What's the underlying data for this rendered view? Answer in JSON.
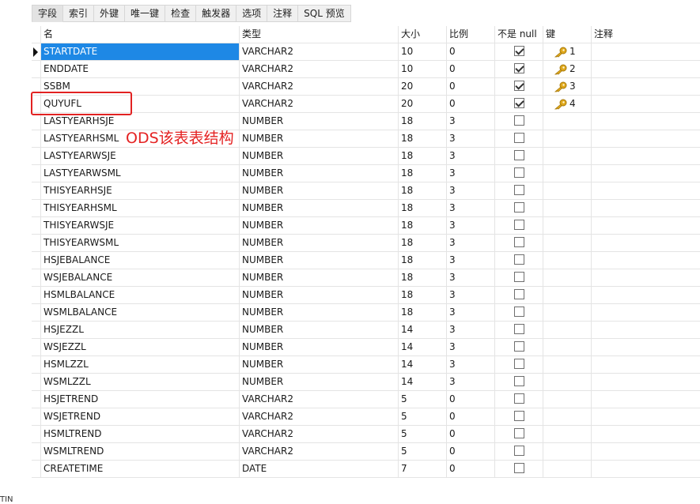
{
  "tabs": [
    {
      "label": "字段",
      "active": true
    },
    {
      "label": "索引",
      "active": false
    },
    {
      "label": "外键",
      "active": false
    },
    {
      "label": "唯一键",
      "active": false
    },
    {
      "label": "检查",
      "active": false
    },
    {
      "label": "触发器",
      "active": false
    },
    {
      "label": "选项",
      "active": false
    },
    {
      "label": "注释",
      "active": false
    },
    {
      "label": "SQL 预览",
      "active": false
    }
  ],
  "columns": {
    "name": "名",
    "type": "类型",
    "size": "大小",
    "scale": "比例",
    "not_null": "不是 null",
    "key": "键",
    "comment": "注释"
  },
  "rows": [
    {
      "name": "STARTDATE",
      "type": "VARCHAR2",
      "size": "10",
      "scale": "0",
      "not_null": true,
      "key": "1"
    },
    {
      "name": "ENDDATE",
      "type": "VARCHAR2",
      "size": "10",
      "scale": "0",
      "not_null": true,
      "key": "2"
    },
    {
      "name": "SSBM",
      "type": "VARCHAR2",
      "size": "20",
      "scale": "0",
      "not_null": true,
      "key": "3"
    },
    {
      "name": "QUYUFL",
      "type": "VARCHAR2",
      "size": "20",
      "scale": "0",
      "not_null": true,
      "key": "4"
    },
    {
      "name": "LASTYEARHSJE",
      "type": "NUMBER",
      "size": "18",
      "scale": "3",
      "not_null": false,
      "key": ""
    },
    {
      "name": "LASTYEARHSML",
      "type": "NUMBER",
      "size": "18",
      "scale": "3",
      "not_null": false,
      "key": ""
    },
    {
      "name": "LASTYEARWSJE",
      "type": "NUMBER",
      "size": "18",
      "scale": "3",
      "not_null": false,
      "key": ""
    },
    {
      "name": "LASTYEARWSML",
      "type": "NUMBER",
      "size": "18",
      "scale": "3",
      "not_null": false,
      "key": ""
    },
    {
      "name": "THISYEARHSJE",
      "type": "NUMBER",
      "size": "18",
      "scale": "3",
      "not_null": false,
      "key": ""
    },
    {
      "name": "THISYEARHSML",
      "type": "NUMBER",
      "size": "18",
      "scale": "3",
      "not_null": false,
      "key": ""
    },
    {
      "name": "THISYEARWSJE",
      "type": "NUMBER",
      "size": "18",
      "scale": "3",
      "not_null": false,
      "key": ""
    },
    {
      "name": "THISYEARWSML",
      "type": "NUMBER",
      "size": "18",
      "scale": "3",
      "not_null": false,
      "key": ""
    },
    {
      "name": "HSJEBALANCE",
      "type": "NUMBER",
      "size": "18",
      "scale": "3",
      "not_null": false,
      "key": ""
    },
    {
      "name": "WSJEBALANCE",
      "type": "NUMBER",
      "size": "18",
      "scale": "3",
      "not_null": false,
      "key": ""
    },
    {
      "name": "HSMLBALANCE",
      "type": "NUMBER",
      "size": "18",
      "scale": "3",
      "not_null": false,
      "key": ""
    },
    {
      "name": "WSMLBALANCE",
      "type": "NUMBER",
      "size": "18",
      "scale": "3",
      "not_null": false,
      "key": ""
    },
    {
      "name": "HSJEZZL",
      "type": "NUMBER",
      "size": "14",
      "scale": "3",
      "not_null": false,
      "key": ""
    },
    {
      "name": "WSJEZZL",
      "type": "NUMBER",
      "size": "14",
      "scale": "3",
      "not_null": false,
      "key": ""
    },
    {
      "name": "HSMLZZL",
      "type": "NUMBER",
      "size": "14",
      "scale": "3",
      "not_null": false,
      "key": ""
    },
    {
      "name": "WSMLZZL",
      "type": "NUMBER",
      "size": "14",
      "scale": "3",
      "not_null": false,
      "key": ""
    },
    {
      "name": "HSJETREND",
      "type": "VARCHAR2",
      "size": "5",
      "scale": "0",
      "not_null": false,
      "key": ""
    },
    {
      "name": "WSJETREND",
      "type": "VARCHAR2",
      "size": "5",
      "scale": "0",
      "not_null": false,
      "key": ""
    },
    {
      "name": "HSMLTREND",
      "type": "VARCHAR2",
      "size": "5",
      "scale": "0",
      "not_null": false,
      "key": ""
    },
    {
      "name": "WSMLTREND",
      "type": "VARCHAR2",
      "size": "5",
      "scale": "0",
      "not_null": false,
      "key": ""
    },
    {
      "name": "CREATETIME",
      "type": "DATE",
      "size": "7",
      "scale": "0",
      "not_null": false,
      "key": ""
    }
  ],
  "selected_row": 0,
  "annotation": {
    "text": "ODS该表表结构",
    "color": "#e42222"
  },
  "bottom_left_text": "TIN",
  "colors": {
    "selection": "#1e88e5",
    "key": "#e0a81c",
    "highlight": "#e22222"
  },
  "icons": {
    "key": "key-icon",
    "row_pointer": "row-pointer-icon"
  }
}
